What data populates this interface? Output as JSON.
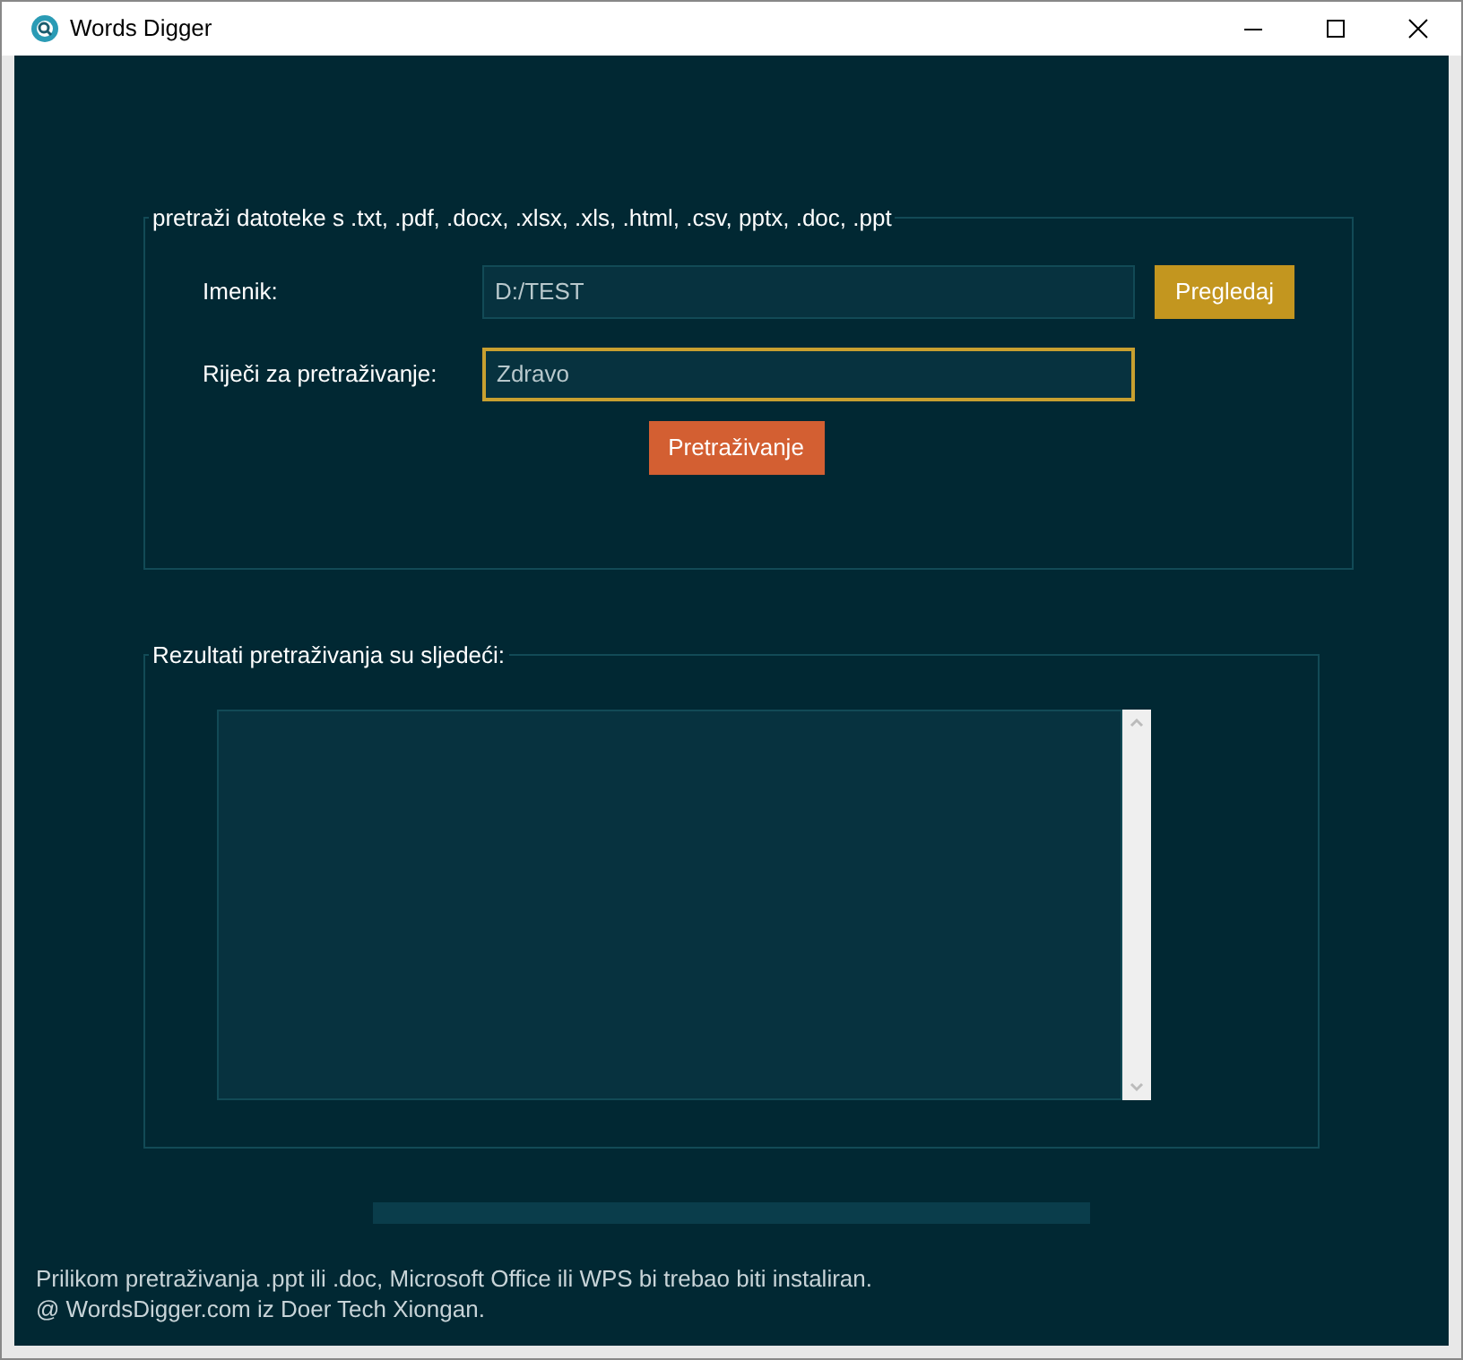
{
  "window": {
    "title": "Words Digger"
  },
  "search_group": {
    "legend": "pretraži datoteke s .txt, .pdf, .docx, .xlsx, .xls, .html, .csv, pptx, .doc, .ppt",
    "directory": {
      "label": "Imenik:",
      "value": "D:/TEST",
      "focused": false
    },
    "browse_button": "Pregledaj",
    "words": {
      "label": "Riječi za pretraživanje:",
      "value": "Zdravo",
      "focused": true
    },
    "search_button": "Pretraživanje"
  },
  "results_group": {
    "legend": "Rezultati pretraživanja su sljedeći:"
  },
  "progress": {
    "level": 0
  },
  "footer": [
    "Prilikom pretraživanja .ppt ili .doc, Microsoft Office ili WPS bi trebao biti instaliran.",
    "@ WordsDigger.com iz Doer Tech Xiongan."
  ]
}
